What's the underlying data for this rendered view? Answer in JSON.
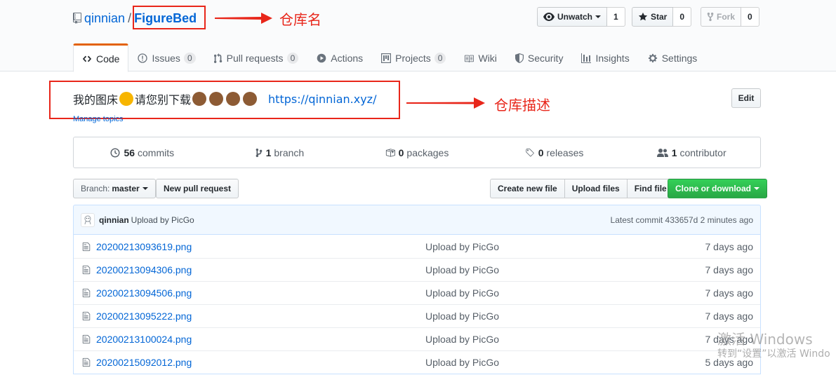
{
  "repo": {
    "owner": "qinnian",
    "separator": "/",
    "name": "FigureBed"
  },
  "actions": {
    "watch_label": "Unwatch",
    "watch_count": "1",
    "star_label": "Star",
    "star_count": "0",
    "fork_label": "Fork",
    "fork_count": "0"
  },
  "tabs": [
    {
      "label": "Code",
      "icon": "code-icon"
    },
    {
      "label": "Issues",
      "count": "0",
      "icon": "issue-icon"
    },
    {
      "label": "Pull requests",
      "count": "0",
      "icon": "pull-request-icon"
    },
    {
      "label": "Actions",
      "icon": "play-icon"
    },
    {
      "label": "Projects",
      "count": "0",
      "icon": "project-icon"
    },
    {
      "label": "Wiki",
      "icon": "book-icon"
    },
    {
      "label": "Security",
      "icon": "shield-icon"
    },
    {
      "label": "Insights",
      "icon": "graph-icon"
    },
    {
      "label": "Settings",
      "icon": "gear-icon"
    }
  ],
  "description": {
    "text_before": "我的图床",
    "text_after": "请您别下载",
    "link": "https://qinnian.xyz/",
    "manage_topics": "Manage topics",
    "edit_label": "Edit"
  },
  "annotations": {
    "repo_name": "仓库名",
    "repo_desc": "仓库描述"
  },
  "summary": {
    "commits_count": "56",
    "commits_label": "commits",
    "branch_count": "1",
    "branch_label": "branch",
    "packages_count": "0",
    "packages_label": "packages",
    "releases_count": "0",
    "releases_label": "releases",
    "contributor_count": "1",
    "contributor_label": "contributor"
  },
  "file_nav": {
    "branch_prefix": "Branch:",
    "branch_name": "master",
    "new_pr": "New pull request",
    "create_file": "Create new file",
    "upload_files": "Upload files",
    "find_file": "Find file",
    "clone": "Clone or download"
  },
  "latest_commit": {
    "author": "qinnian",
    "message": "Upload by PicGo",
    "meta": "Latest commit 433657d 2 minutes ago"
  },
  "files": [
    {
      "name": "20200213093619.png",
      "commit": "Upload by PicGo",
      "age": "7 days ago"
    },
    {
      "name": "20200213094306.png",
      "commit": "Upload by PicGo",
      "age": "7 days ago"
    },
    {
      "name": "20200213094506.png",
      "commit": "Upload by PicGo",
      "age": "7 days ago"
    },
    {
      "name": "20200213095222.png",
      "commit": "Upload by PicGo",
      "age": "7 days ago"
    },
    {
      "name": "20200213100024.png",
      "commit": "Upload by PicGo",
      "age": "7 days ago"
    },
    {
      "name": "20200215092012.png",
      "commit": "Upload by PicGo",
      "age": "5 days ago"
    }
  ],
  "watermark": {
    "title": "激活 Windows",
    "subtitle": "转到“设置”以激活 Windo"
  },
  "colors": {
    "link": "#0366d6",
    "annotation": "#e8261a",
    "clone_green": "#28a745",
    "tab_accent": "#e36209"
  }
}
